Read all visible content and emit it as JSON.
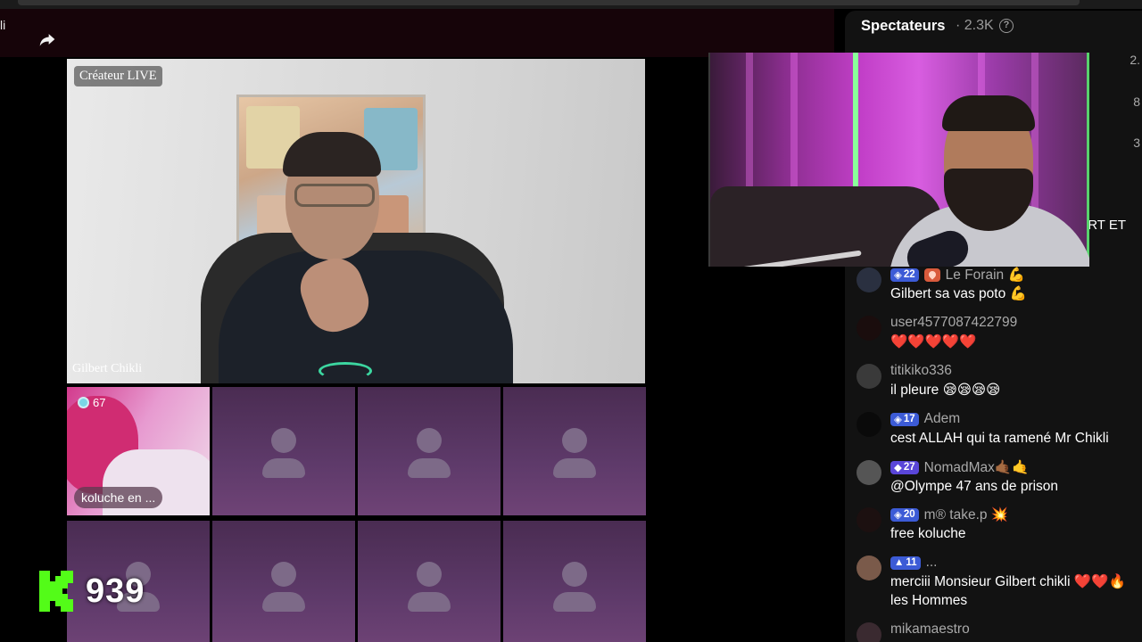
{
  "top_left_glyph": "li",
  "main_video": {
    "top_label": "Créateur LIVE",
    "host_name": "Gilbert Chikli"
  },
  "guests": [
    {
      "name": "koluche en ...",
      "gift_count": "67"
    },
    {
      "name": ""
    },
    {
      "name": ""
    },
    {
      "name": ""
    },
    {
      "name": ""
    },
    {
      "name": ""
    },
    {
      "name": ""
    },
    {
      "name": ""
    }
  ],
  "kick_overlay": {
    "count": "939",
    "accent_color": "#53fc18"
  },
  "panel": {
    "title": "Spectateurs",
    "viewer_count": "· 2.3K",
    "help_glyph": "?",
    "edge_numbers": [
      "2.",
      "8",
      "3"
    ],
    "edge_text": "RT ET"
  },
  "messages": [
    {
      "badge": "22",
      "fan_badge": true,
      "user": "Le Forain 💪",
      "text": "Gilbert sa vas poto 💪"
    },
    {
      "badge": "",
      "user": "user4577087422799",
      "text": "❤️❤️❤️❤️❤️"
    },
    {
      "badge": "",
      "user": "titikiko336",
      "text": "il pleure 😪😪😪😪"
    },
    {
      "badge": "17",
      "user": "Adem",
      "text": "cest ALLAH qui ta ramené Mr Chikli"
    },
    {
      "badge": "27",
      "badge_style": "purple",
      "user": "NomadMax🤙🏾🤙",
      "text": "@Olympe 47 ans de prison"
    },
    {
      "badge": "20",
      "user": "m® take.p 💥",
      "text": "free koluche"
    },
    {
      "badge": "11",
      "user": "...",
      "text": "merciii Monsieur Gilbert chikli ❤️❤️🔥",
      "text2": "les Hommes"
    },
    {
      "badge": "",
      "user": "mikamaestro",
      "text": ""
    }
  ]
}
